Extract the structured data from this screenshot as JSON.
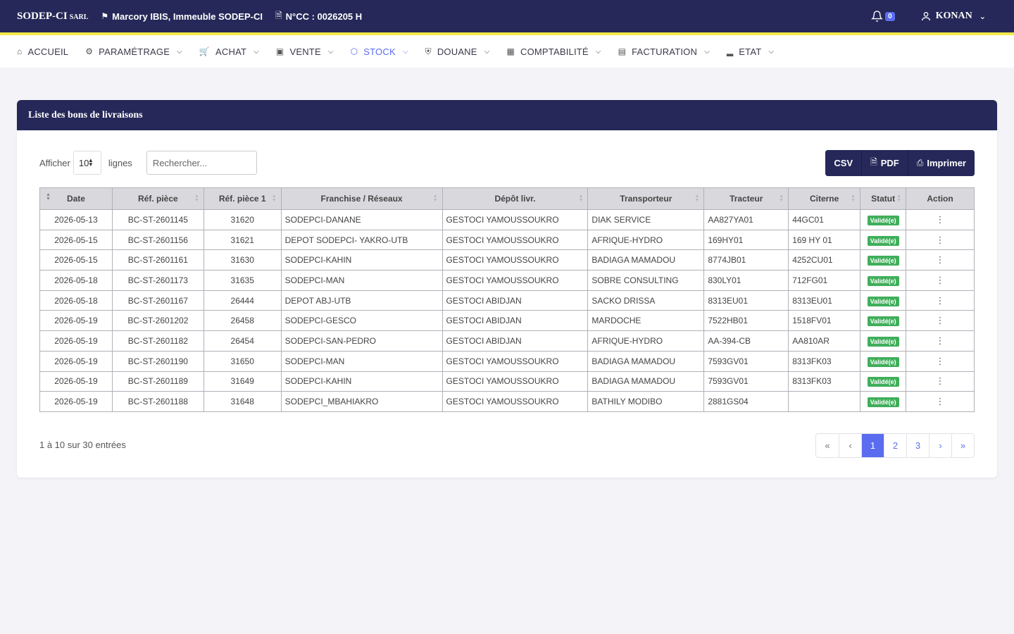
{
  "topbar": {
    "brand": "SODEP-CI",
    "brand_suffix": "SARL",
    "address": "Marcory IBIS, Immeuble SODEP-CI",
    "ncc": "N°CC : 0026205 H",
    "notifications": "0",
    "user": "KONAN"
  },
  "nav": [
    {
      "label": "ACCUEIL",
      "icon": "home-icon"
    },
    {
      "label": "PARAMÉTRAGE",
      "icon": "gear-icon"
    },
    {
      "label": "ACHAT",
      "icon": "cart-icon"
    },
    {
      "label": "VENTE",
      "icon": "cash-icon"
    },
    {
      "label": "STOCK",
      "icon": "box-icon"
    },
    {
      "label": "DOUANE",
      "icon": "shield-icon"
    },
    {
      "label": "COMPTABILITÉ",
      "icon": "ledger-icon"
    },
    {
      "label": "FACTURATION",
      "icon": "invoice-icon"
    },
    {
      "label": "ETAT",
      "icon": "chart-icon"
    }
  ],
  "colors": {
    "primary": "#252858",
    "accent": "#5b6cf0",
    "success": "#3fae5a",
    "highlight": "#f2e84a"
  },
  "card": {
    "title": "Liste des bons de livraisons"
  },
  "controls": {
    "show_label": "Afficher",
    "show_value": "10",
    "lines_label": "lignes",
    "search_placeholder": "Rechercher..."
  },
  "export": {
    "csv": "CSV",
    "pdf": "PDF",
    "print": "Imprimer"
  },
  "table": {
    "headers": [
      "Date",
      "Réf. pièce",
      "Réf. pièce 1",
      "Franchise / Réseaux",
      "Dépôt livr.",
      "Transporteur",
      "Tracteur",
      "Citerne",
      "Statut",
      "Action"
    ],
    "rows": [
      {
        "date": "2026-05-13",
        "ref": "BC-ST-2601145",
        "ref1": "31620",
        "franchise": "SODEPCI-DANANE",
        "depot": "GESTOCI YAMOUSSOUKRO",
        "transporteur": "DIAK SERVICE",
        "tracteur": "AA827YA01",
        "citerne": "44GC01",
        "statut": "Validé(e)"
      },
      {
        "date": "2026-05-15",
        "ref": "BC-ST-2601156",
        "ref1": "31621",
        "franchise": "DEPOT SODEPCI- YAKRO-UTB",
        "depot": "GESTOCI YAMOUSSOUKRO",
        "transporteur": "AFRIQUE-HYDRO",
        "tracteur": "169HY01",
        "citerne": "169 HY 01",
        "statut": "Validé(e)"
      },
      {
        "date": "2026-05-15",
        "ref": "BC-ST-2601161",
        "ref1": "31630",
        "franchise": "SODEPCI-KAHIN",
        "depot": "GESTOCI YAMOUSSOUKRO",
        "transporteur": "BADIAGA MAMADOU",
        "tracteur": "8774JB01",
        "citerne": "4252CU01",
        "statut": "Validé(e)"
      },
      {
        "date": "2026-05-18",
        "ref": "BC-ST-2601173",
        "ref1": "31635",
        "franchise": "SODEPCI-MAN",
        "depot": "GESTOCI YAMOUSSOUKRO",
        "transporteur": "SOBRE CONSULTING",
        "tracteur": "830LY01",
        "citerne": "712FG01",
        "statut": "Validé(e)"
      },
      {
        "date": "2026-05-18",
        "ref": "BC-ST-2601167",
        "ref1": "26444",
        "franchise": "DEPOT ABJ-UTB",
        "depot": "GESTOCI ABIDJAN",
        "transporteur": "SACKO DRISSA",
        "tracteur": "8313EU01",
        "citerne": "8313EU01",
        "statut": "Validé(e)"
      },
      {
        "date": "2026-05-19",
        "ref": "BC-ST-2601202",
        "ref1": "26458",
        "franchise": "SODEPCI-GESCO",
        "depot": "GESTOCI ABIDJAN",
        "transporteur": "MARDOCHE",
        "tracteur": "7522HB01",
        "citerne": "1518FV01",
        "statut": "Validé(e)"
      },
      {
        "date": "2026-05-19",
        "ref": "BC-ST-2601182",
        "ref1": "26454",
        "franchise": "SODEPCI-SAN-PEDRO",
        "depot": "GESTOCI ABIDJAN",
        "transporteur": "AFRIQUE-HYDRO",
        "tracteur": "AA-394-CB",
        "citerne": "AA810AR",
        "statut": "Validé(e)"
      },
      {
        "date": "2026-05-19",
        "ref": "BC-ST-2601190",
        "ref1": "31650",
        "franchise": "SODEPCI-MAN",
        "depot": "GESTOCI YAMOUSSOUKRO",
        "transporteur": "BADIAGA MAMADOU",
        "tracteur": "7593GV01",
        "citerne": "8313FK03",
        "statut": "Validé(e)"
      },
      {
        "date": "2026-05-19",
        "ref": "BC-ST-2601189",
        "ref1": "31649",
        "franchise": "SODEPCI-KAHIN",
        "depot": "GESTOCI YAMOUSSOUKRO",
        "transporteur": "BADIAGA MAMADOU",
        "tracteur": "7593GV01",
        "citerne": "8313FK03",
        "statut": "Validé(e)"
      },
      {
        "date": "2026-05-19",
        "ref": "BC-ST-2601188",
        "ref1": "31648",
        "franchise": "SODEPCI_MBAHIAKRO",
        "depot": "GESTOCI YAMOUSSOUKRO",
        "transporteur": "BATHILY MODIBO",
        "tracteur": "2881GS04",
        "citerne": "",
        "statut": "Validé(e)"
      }
    ]
  },
  "pagination": {
    "info": "1 à 10 sur 30 entrées",
    "first": "«",
    "prev": "‹",
    "pages": [
      "1",
      "2",
      "3"
    ],
    "next": "›",
    "last": "»",
    "current": "1"
  }
}
